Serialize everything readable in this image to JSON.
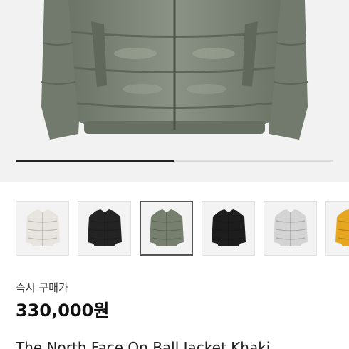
{
  "product": {
    "image_carousel": {
      "progress": 0.5,
      "active_index": 2,
      "thumbnails": [
        {
          "name": "ivory",
          "color": "#e8e4df"
        },
        {
          "name": "black",
          "color": "#232323"
        },
        {
          "name": "khaki",
          "color": "#77806f"
        },
        {
          "name": "black-matte",
          "color": "#1d1d1d"
        },
        {
          "name": "light-grey",
          "color": "#d4d4d4"
        },
        {
          "name": "yellow",
          "color": "#e6a61f"
        }
      ]
    },
    "price_label": "즉시 구매가",
    "price": "330,000원",
    "title": "The North Face On Ball Jacket Khaki"
  },
  "colors": {
    "jacket_main": "#7a8475",
    "jacket_shadow": "#5d665a",
    "background": "#f2f2f3"
  }
}
